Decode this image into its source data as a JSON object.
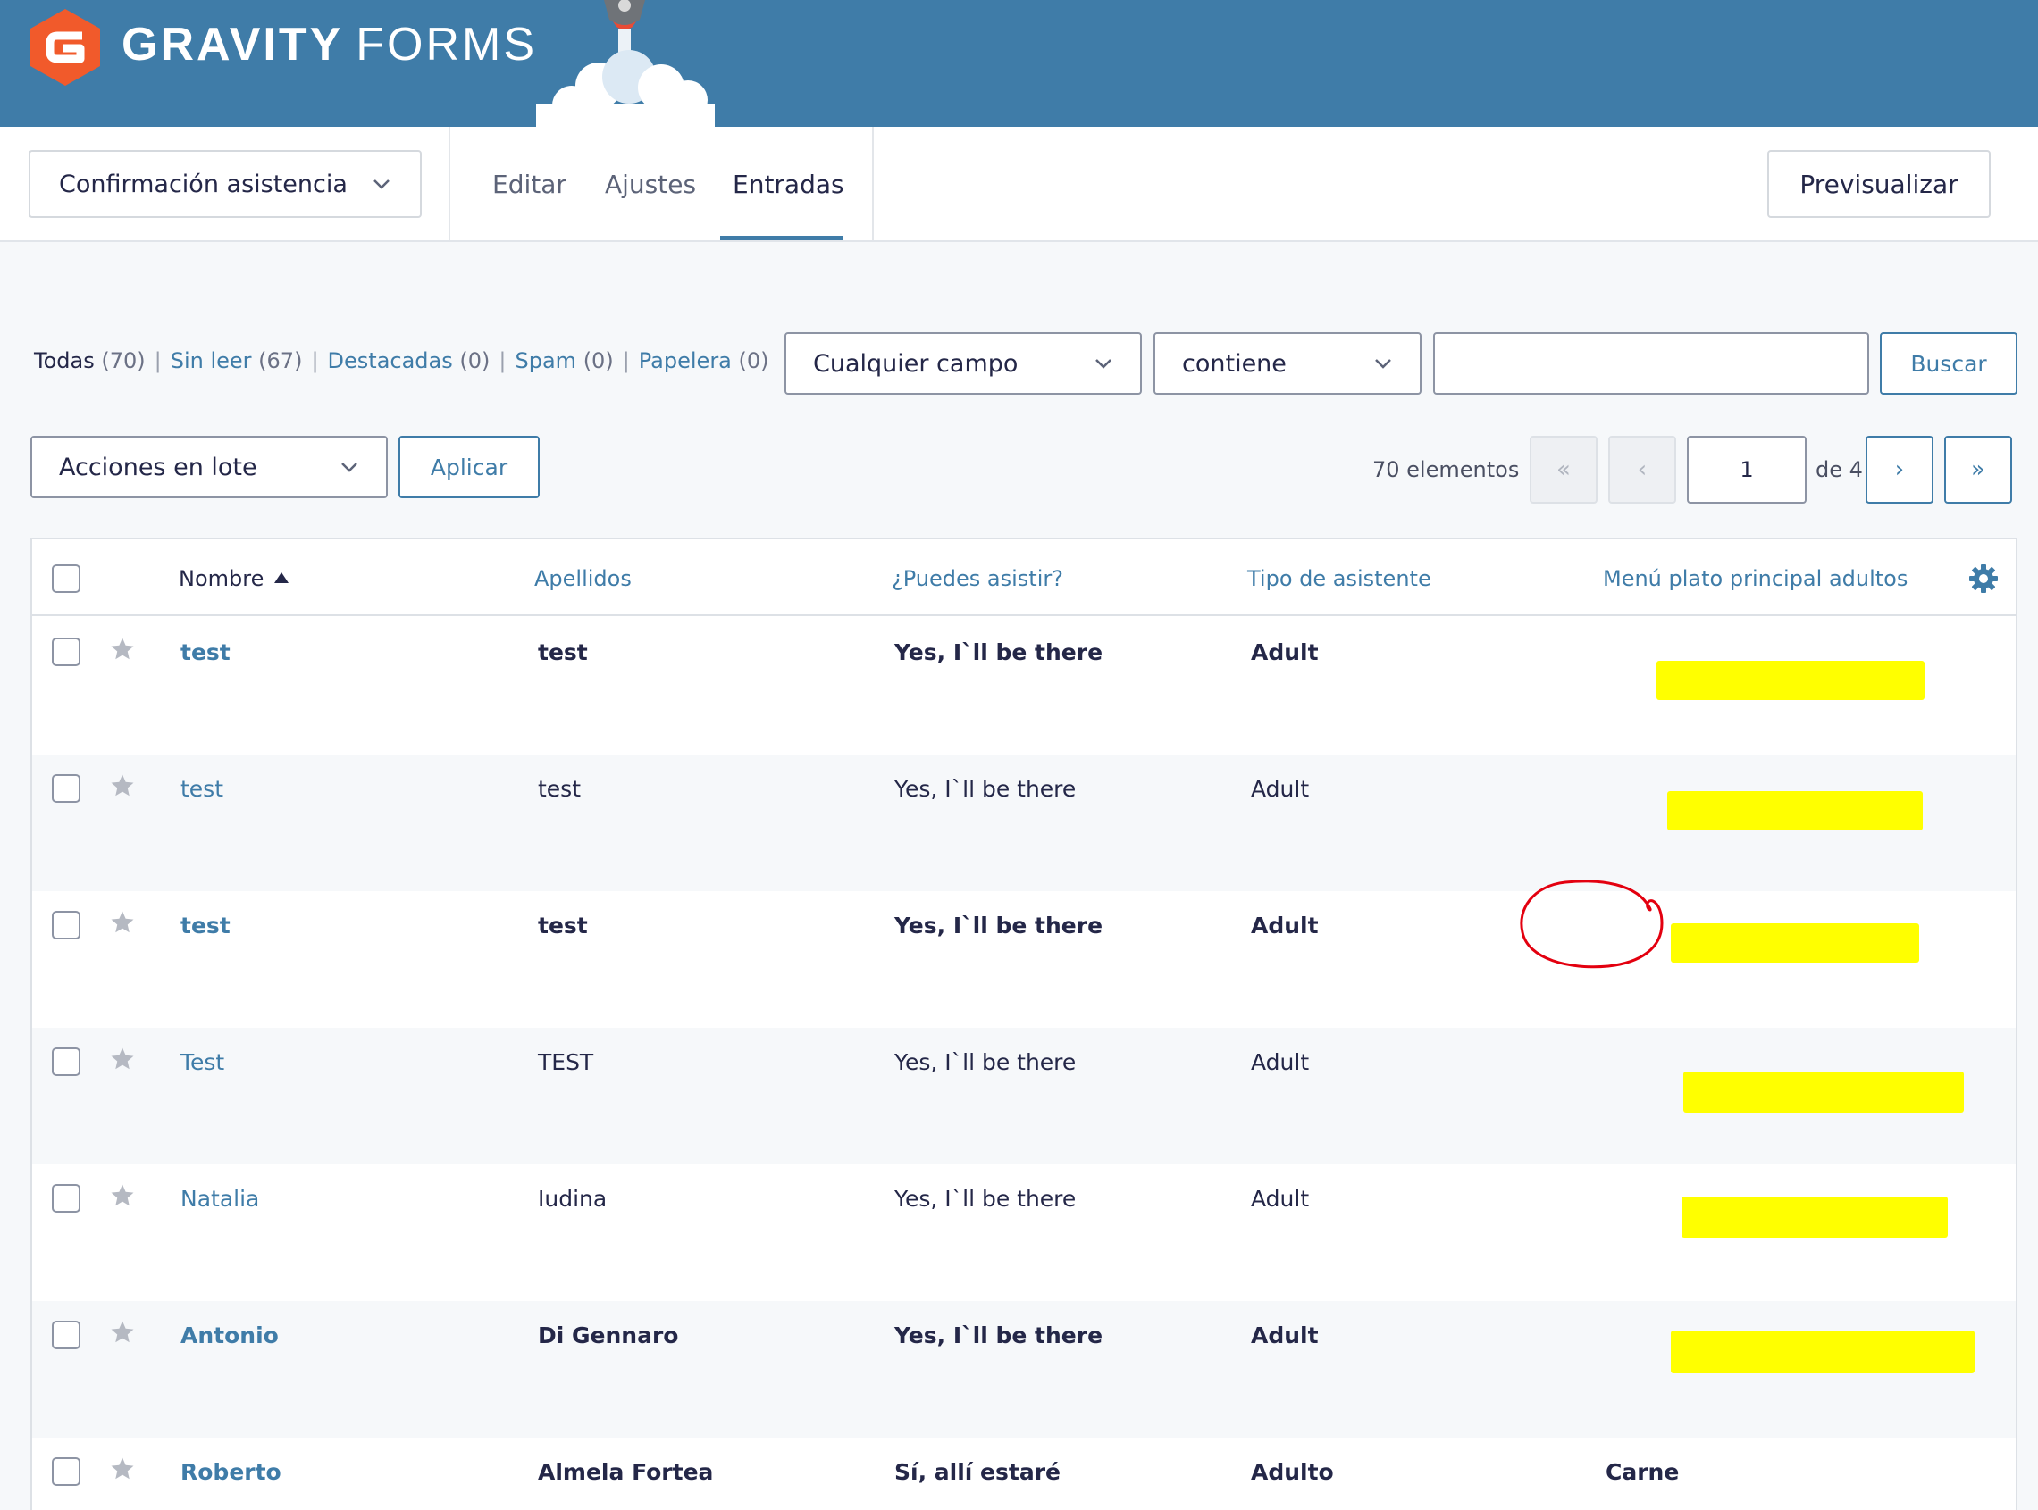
{
  "brand": {
    "name_bold": "GRAVITY",
    "name_light": "FORMS"
  },
  "colors": {
    "header": "#3f7ca8",
    "accent": "#3f7ca8",
    "logo": "#f15a2b",
    "highlight": "#ffff00",
    "annotation": "#e3000f"
  },
  "form_selector": {
    "value": "Confirmación asistencia"
  },
  "tabs": [
    {
      "label": "Editar"
    },
    {
      "label": "Ajustes"
    },
    {
      "label": "Entradas",
      "active": true
    }
  ],
  "preview_button": "Previsualizar",
  "filters": [
    {
      "label": "Todas",
      "count": "(70)",
      "current": true
    },
    {
      "label": "Sin leer",
      "count": "(67)"
    },
    {
      "label": "Destacadas",
      "count": "(0)"
    },
    {
      "label": "Spam",
      "count": "(0)"
    },
    {
      "label": "Papelera",
      "count": "(0)"
    }
  ],
  "search": {
    "field": "Cualquier campo",
    "operator": "contiene",
    "value": "",
    "button": "Buscar"
  },
  "bulk": {
    "select": "Acciones en lote",
    "apply": "Aplicar"
  },
  "pagination": {
    "count_text": "70 elementos",
    "first": "«",
    "prev": "‹",
    "page": "1",
    "of_text": "de 4",
    "next": "›",
    "last": "»"
  },
  "table": {
    "columns": [
      "Nombre",
      "Apellidos",
      "¿Puedes asistir?",
      "Tipo de asistente",
      "Menú plato principal adultos"
    ],
    "sorted_column": "Nombre",
    "rows": [
      {
        "nombre": "test",
        "apellidos": "test",
        "asistir": "Yes, I`ll be there",
        "tipo": "Adult",
        "menu": "",
        "unread": true,
        "menu_redacted": true
      },
      {
        "nombre": "test",
        "apellidos": "test",
        "asistir": "Yes, I`ll be there",
        "tipo": "Adult",
        "menu": "",
        "unread": false,
        "menu_redacted": true
      },
      {
        "nombre": "test",
        "apellidos": "test",
        "asistir": "Yes, I`ll be there",
        "tipo": "Adult",
        "menu": "",
        "unread": true,
        "menu_redacted": true
      },
      {
        "nombre": "Test",
        "apellidos": "TEST",
        "asistir": "Yes, I`ll be there",
        "tipo": "Adult",
        "menu": "",
        "unread": false,
        "menu_redacted": true
      },
      {
        "nombre": "Natalia",
        "apellidos": "Iudina",
        "asistir": "Yes, I`ll be there",
        "tipo": "Adult",
        "menu": "",
        "unread": false,
        "menu_redacted": true
      },
      {
        "nombre": "Antonio",
        "apellidos": "Di Gennaro",
        "asistir": "Yes, I`ll be there",
        "tipo": "Adult",
        "menu": "",
        "unread": true,
        "menu_redacted": true
      },
      {
        "nombre": "Roberto",
        "apellidos": "Almela Fortea",
        "asistir": "Sí, allí estaré",
        "tipo": "Adulto",
        "menu": "Carne",
        "unread": true,
        "menu_redacted": false
      }
    ]
  }
}
